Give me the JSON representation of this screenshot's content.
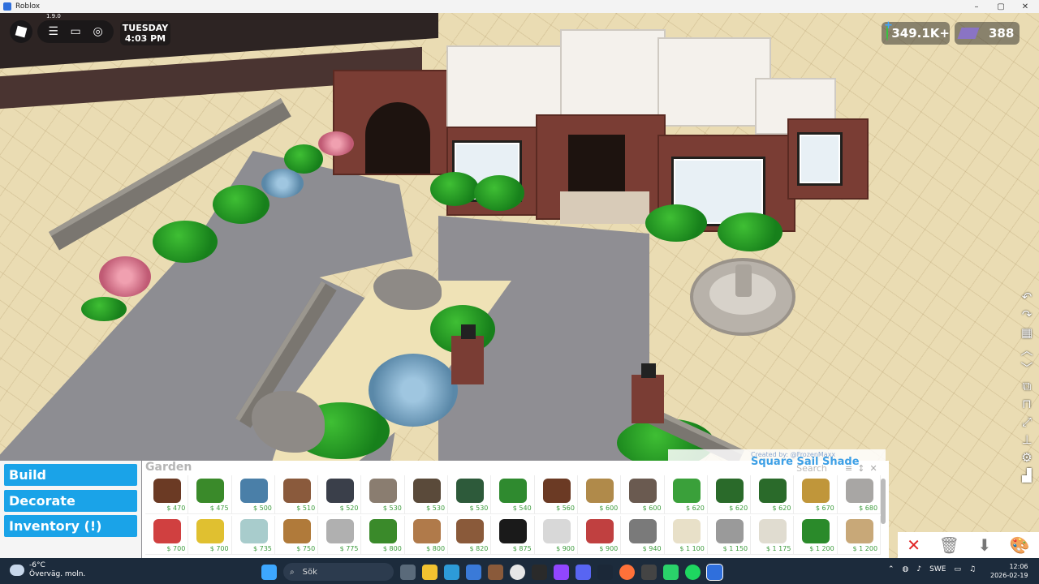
{
  "window": {
    "title": "Roblox",
    "min": "–",
    "max": "▢",
    "close": "✕"
  },
  "hud": {
    "version": "1.9.0",
    "day": "TUESDAY",
    "time": "4:03 PM",
    "money": "349.1K+",
    "bucks": "388"
  },
  "build_menu": {
    "build": "Build",
    "decorate": "Decorate",
    "inventory": "Inventory (!)"
  },
  "catalogue": {
    "category": "Garden",
    "credit": "Created by: @FrozenMaxx",
    "selected_name": "Square Sail Shade",
    "search_placeholder": "Search",
    "items_row1": [
      {
        "price": "$ 470",
        "color": "#6b3a24"
      },
      {
        "price": "$ 475",
        "color": "#3a8a2a"
      },
      {
        "price": "$ 500",
        "color": "#4a7fa8"
      },
      {
        "price": "$ 510",
        "color": "#8a5a3c"
      },
      {
        "price": "$ 520",
        "color": "#3a3f4a"
      },
      {
        "price": "$ 530",
        "color": "#8a7d70"
      },
      {
        "price": "$ 530",
        "color": "#5a4a3a"
      },
      {
        "price": "$ 530",
        "color": "#2d5a3a"
      },
      {
        "price": "$ 540",
        "color": "#2f8a2f"
      },
      {
        "price": "$ 560",
        "color": "#6b3a24"
      },
      {
        "price": "$ 600",
        "color": "#b08a4a"
      },
      {
        "price": "$ 600",
        "color": "#6a5a50"
      },
      {
        "price": "$ 620",
        "color": "#3aa03a"
      },
      {
        "price": "$ 620",
        "color": "#2a6a2a"
      },
      {
        "price": "$ 620",
        "color": "#2a6a2a"
      },
      {
        "price": "$ 670",
        "color": "#c0963a"
      },
      {
        "price": "$ 680",
        "color": "#a8a6a4"
      }
    ],
    "items_row2": [
      {
        "price": "$ 700",
        "color": "#d04040"
      },
      {
        "price": "$ 700",
        "color": "#e0c030"
      },
      {
        "price": "$ 735",
        "color": "#a8cccc"
      },
      {
        "price": "$ 750",
        "color": "#b07a3a"
      },
      {
        "price": "$ 775",
        "color": "#b0b0b0"
      },
      {
        "price": "$ 800",
        "color": "#3a8a2a"
      },
      {
        "price": "$ 800",
        "color": "#b07a4a"
      },
      {
        "price": "$ 820",
        "color": "#8a5a3a"
      },
      {
        "price": "$ 875",
        "color": "#1a1a1a"
      },
      {
        "price": "$ 900",
        "color": "#d8d8d8"
      },
      {
        "price": "$ 900",
        "color": "#c04040"
      },
      {
        "price": "$ 940",
        "color": "#7a7a7a"
      },
      {
        "price": "$ 1 100",
        "color": "#e8e0c8"
      },
      {
        "price": "$ 1 150",
        "color": "#9a9a9a"
      },
      {
        "price": "$ 1 175",
        "color": "#e0dcd0"
      },
      {
        "price": "$ 1 200",
        "color": "#2a8a2a"
      },
      {
        "price": "$ 1 200",
        "color": "#c8a878"
      }
    ],
    "actions": {
      "close": "✕",
      "delete": "🗑",
      "stamp": "⬇",
      "palette": "🎨"
    }
  },
  "tools": [
    "↶",
    "↷",
    "▦",
    "︿",
    "﹀",
    "⧉",
    "⊓",
    "⤢",
    "⊥",
    "⚙",
    "▟"
  ],
  "taskbar": {
    "temp": "-6°C",
    "weather": "Överväg. moln.",
    "search": "Sök",
    "lang": "SWE",
    "clock_time": "12:06",
    "clock_date": "2026-02-19"
  }
}
